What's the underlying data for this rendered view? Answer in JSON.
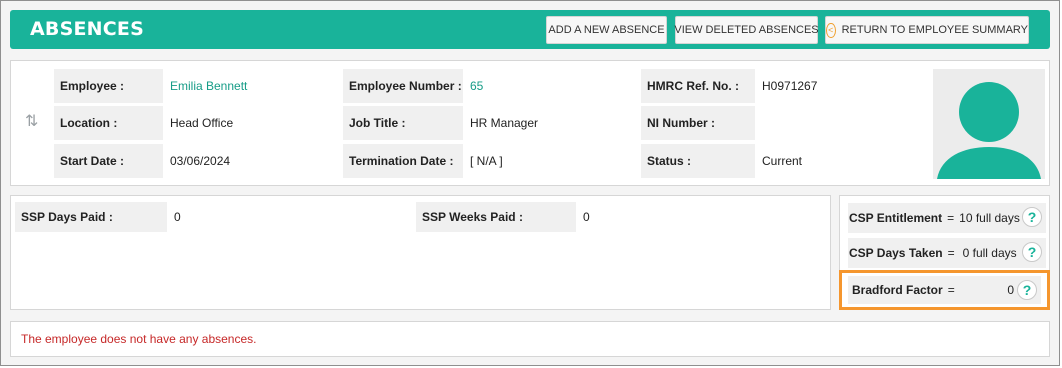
{
  "header": {
    "title": "ABSENCES",
    "buttons": {
      "add": "ADD A NEW ABSENCE",
      "deleted": "VIEW DELETED ABSENCES",
      "back": "RETURN TO EMPLOYEE SUMMARY"
    }
  },
  "employee": {
    "employee_label": "Employee :",
    "employee_value": "Emilia Bennett",
    "number_label": "Employee Number :",
    "number_value": "65",
    "hmrc_label": "HMRC Ref. No. :",
    "hmrc_value": "H0971267",
    "location_label": "Location :",
    "location_value": "Head Office",
    "job_label": "Job Title :",
    "job_value": "HR Manager",
    "ni_label": "NI Number :",
    "ni_value": "",
    "start_label": "Start Date :",
    "start_value": "03/06/2024",
    "termination_label": "Termination Date :",
    "termination_value": "[ N/A ]",
    "status_label": "Status :",
    "status_value": "Current"
  },
  "ssp": {
    "days_label": "SSP Days Paid :",
    "days_value": "0",
    "weeks_label": "SSP Weeks Paid :",
    "weeks_value": "0"
  },
  "csp": {
    "entitlement_label": "CSP Entitlement",
    "entitlement_value": "10 full days",
    "taken_label": "CSP Days Taken",
    "taken_value": "0 full days",
    "bradford_label": "Bradford Factor",
    "bradford_value": "0",
    "equals": "="
  },
  "message": "The employee does not have any absences.",
  "icons": [
    "back-arrow-icon",
    "sort-icon",
    "avatar-icon",
    "help-icon"
  ],
  "colors": {
    "accent": "#19b39a",
    "highlight": "#f5962e",
    "error": "#c62828"
  }
}
